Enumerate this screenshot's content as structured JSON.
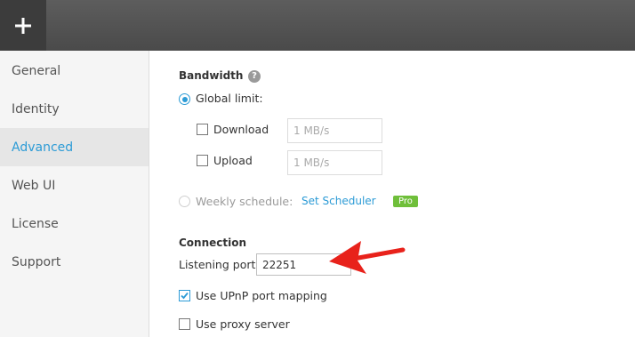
{
  "topbar": {
    "add_icon": "plus-icon"
  },
  "sidebar": {
    "items": [
      {
        "label": "General",
        "active": false
      },
      {
        "label": "Identity",
        "active": false
      },
      {
        "label": "Advanced",
        "active": true
      },
      {
        "label": "Web UI",
        "active": false
      },
      {
        "label": "License",
        "active": false
      },
      {
        "label": "Support",
        "active": false
      }
    ]
  },
  "bandwidth": {
    "heading": "Bandwidth",
    "help_glyph": "?",
    "global_limit_label": "Global limit:",
    "download_label": "Download",
    "download_value": "1 MB/s",
    "upload_label": "Upload",
    "upload_value": "1 MB/s",
    "weekly_label": "Weekly schedule:",
    "scheduler_link": "Set Scheduler",
    "pro_badge": "Pro"
  },
  "connection": {
    "heading": "Connection",
    "listening_port_label": "Listening port:",
    "listening_port_value": "22251",
    "upnp_label": "Use UPnP port mapping",
    "upnp_checked": true,
    "proxy_label": "Use proxy server",
    "proxy_checked": false
  },
  "colors": {
    "accent": "#2c9bd6",
    "pro": "#6fbf3a",
    "annotation_arrow": "#e8221b"
  }
}
